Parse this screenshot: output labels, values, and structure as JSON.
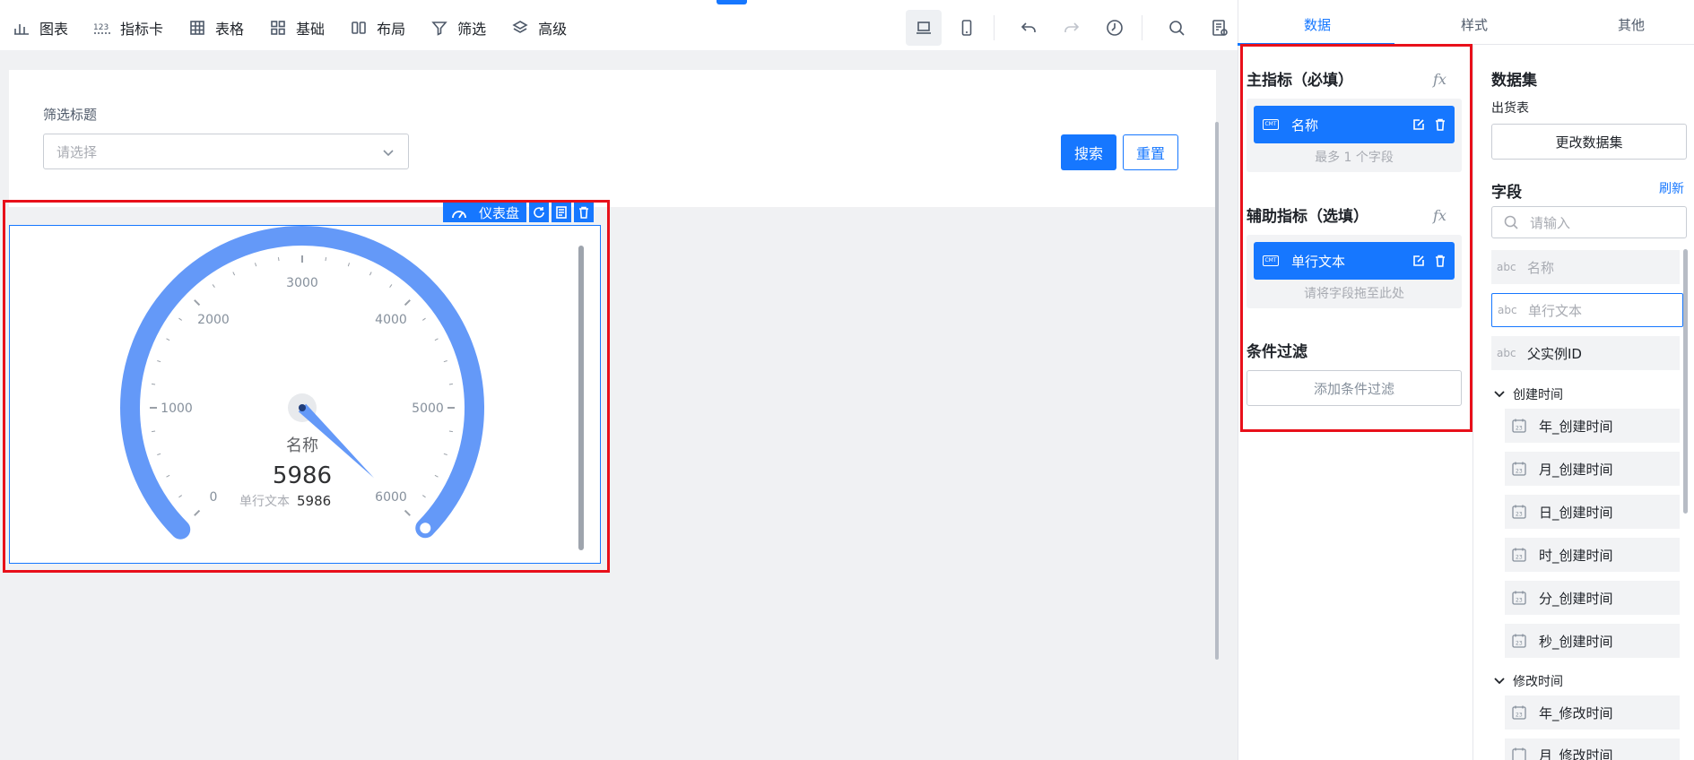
{
  "toolbar": {
    "items": [
      {
        "label": "图表",
        "icon": "bar-chart-icon"
      },
      {
        "label": "指标卡",
        "icon": "number-123-icon"
      },
      {
        "label": "表格",
        "icon": "table-grid-icon"
      },
      {
        "label": "基础",
        "icon": "four-squares-icon"
      },
      {
        "label": "布局",
        "icon": "columns-layout-icon"
      },
      {
        "label": "筛选",
        "icon": "funnel-icon"
      },
      {
        "label": "高级",
        "icon": "layers-icon"
      }
    ]
  },
  "filter": {
    "title": "筛选标题",
    "select_placeholder": "请选择",
    "search_label": "搜索",
    "reset_label": "重置"
  },
  "gauge_widget": {
    "type_label": "仪表盘",
    "metric_name": "名称",
    "value": "5986",
    "aux_label": "单行文本",
    "aux_value": "5986",
    "min": 0,
    "max": 6000,
    "current": 5986,
    "tick_labels": [
      "0",
      "1000",
      "2000",
      "3000",
      "4000",
      "5000",
      "6000"
    ],
    "accent": "#6499f8"
  },
  "panel": {
    "tabs": [
      "数据",
      "样式",
      "其他"
    ],
    "active_tab": "数据",
    "main_metric": {
      "title": "主指标（必填）",
      "field": "名称",
      "hint": "最多 1 个字段"
    },
    "aux_metric": {
      "title": "辅助指标（选填）",
      "field": "单行文本",
      "hint": "请将字段拖至此处"
    },
    "condition": {
      "title": "条件过滤",
      "button": "添加条件过滤"
    },
    "fx": "fx",
    "dataset": {
      "title": "数据集",
      "name": "出货表",
      "change_button": "更改数据集"
    },
    "fields": {
      "title": "字段",
      "refresh": "刷新",
      "search_placeholder": "请输入",
      "type_tag": "abc",
      "items": [
        {
          "label": "名称",
          "state": "dim"
        },
        {
          "label": "单行文本",
          "state": "selected"
        },
        {
          "label": "父实例ID",
          "state": "normal"
        }
      ],
      "groups": [
        {
          "label": "创建时间",
          "children": [
            "年_创建时间",
            "月_创建时间",
            "日_创建时间",
            "时_创建时间",
            "分_创建时间",
            "秒_创建时间"
          ]
        },
        {
          "label": "修改时间",
          "children": [
            "年_修改时间",
            "月_修改时间"
          ]
        }
      ]
    }
  },
  "colors": {
    "primary": "#1677ff",
    "highlight": "#e8101a"
  }
}
